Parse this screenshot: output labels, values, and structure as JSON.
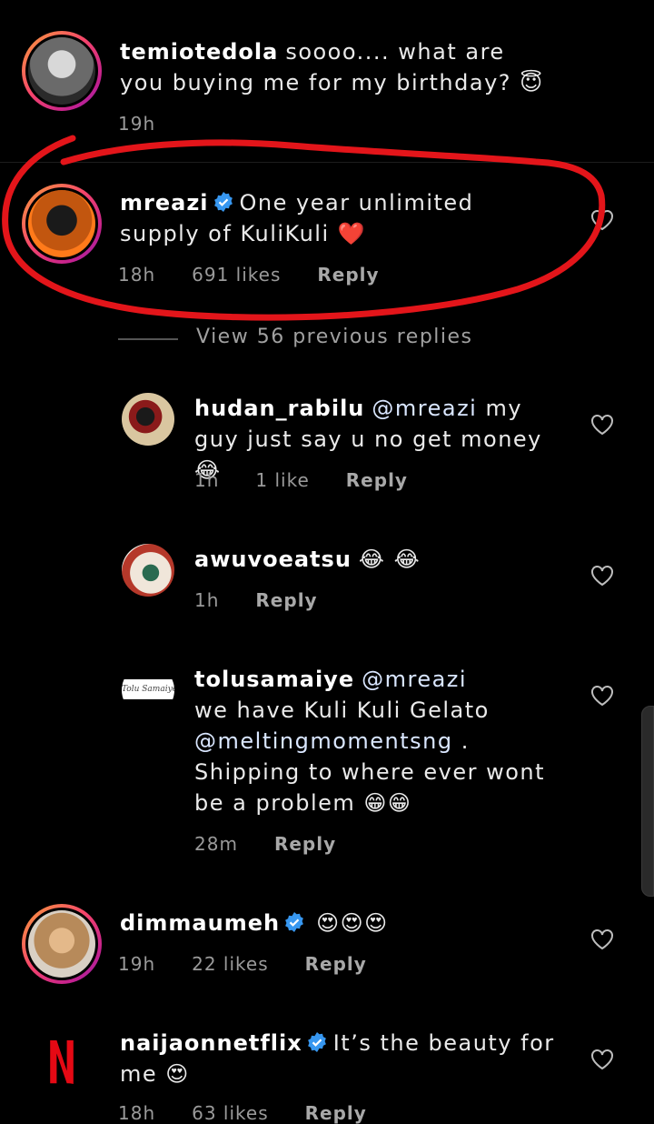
{
  "comments": [
    {
      "username": "temiotedola",
      "text": "soooo.... what are you buying me for my birthday? 😇",
      "time": "19h"
    },
    {
      "username": "mreazi",
      "text": "One year unlimited supply of KuliKuli ❤️",
      "time": "18h",
      "likes": "691 likes",
      "reply": "Reply"
    },
    {
      "username": "hudan_rabilu",
      "mention": "@mreazi",
      "text": " my guy just say u no get money 😂",
      "time": "1h",
      "likes": "1 like",
      "reply": "Reply"
    },
    {
      "username": "awuvoeatsu",
      "text": "😂 😂",
      "time": "1h",
      "reply": "Reply"
    },
    {
      "username": "tolusamaiye",
      "mention": "@mreazi",
      "line2": "we have Kuli Kuli Gelato",
      "mention2": "@meltingmomentsng",
      "text": " . Shipping to where ever wont be a problem 😁😁",
      "time": "28m",
      "reply": "Reply",
      "avatar_text": "Tolu Samaiye"
    },
    {
      "username": "dimmaumeh",
      "text": "😍😍😍",
      "time": "19h",
      "likes": "22 likes",
      "reply": "Reply"
    },
    {
      "username": "naijaonnetflix",
      "text": "It’s the beauty for me 😍",
      "time": "18h",
      "likes": "63 likes",
      "reply": "Reply"
    }
  ],
  "view_previous": "View 56 previous replies",
  "colors": {
    "background": "#000000",
    "ring_start": "#f9a03a",
    "ring_end": "#8a2ab7",
    "verified": "#3797f0",
    "netflix": "#e50914",
    "annotation": "#e3151a"
  }
}
